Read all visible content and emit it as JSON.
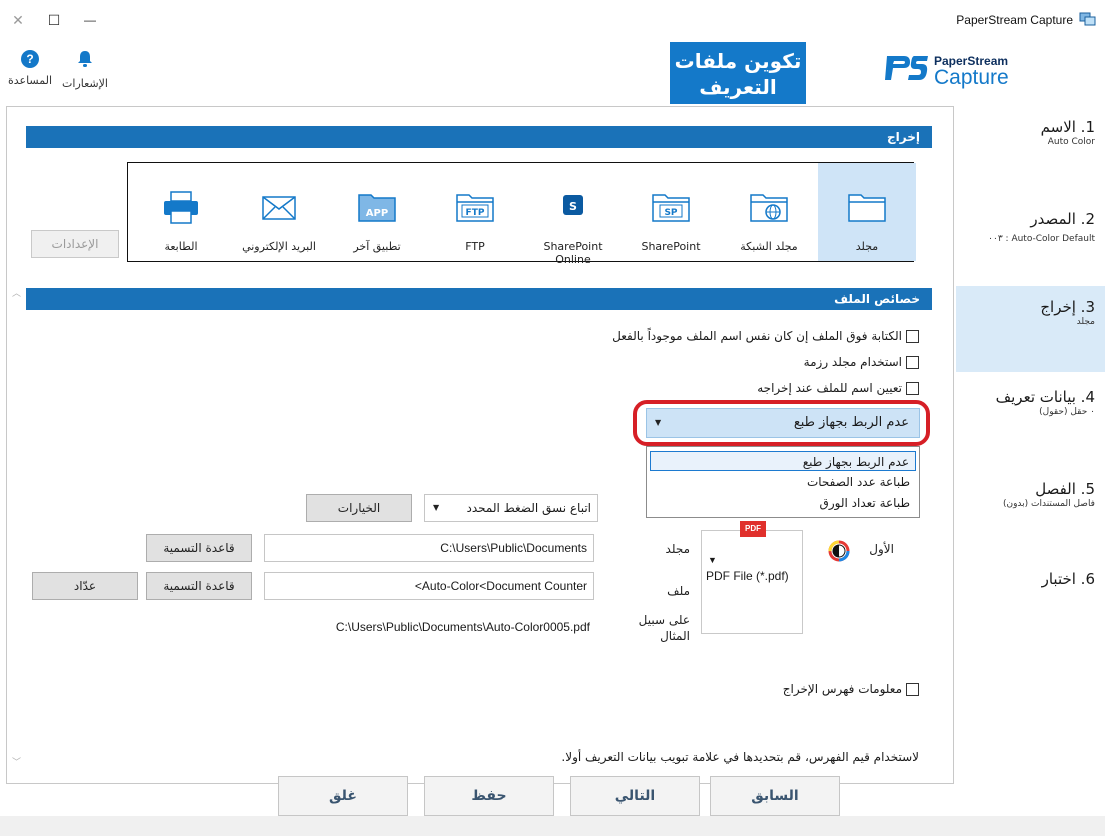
{
  "window": {
    "title": "PaperStream Capture",
    "close_glyph": "✕",
    "maximize_glyph": "☐",
    "minimize_glyph": "—"
  },
  "header": {
    "help_label": "المساعدة",
    "notifications_label": "الإشعارات",
    "profile_title_line1": "تكوين ملفات",
    "profile_title_line2": "التعريف",
    "logo_top": "PaperStream",
    "logo_bottom": "Capture"
  },
  "sections": {
    "output_header": "إخراج",
    "file_props_header": "خصائص الملف"
  },
  "destinations": [
    {
      "label": "مجلد",
      "icon": "folder-icon",
      "selected": true
    },
    {
      "label": "مجلد الشبكة",
      "icon": "network-folder-icon",
      "selected": false
    },
    {
      "label": "SharePoint",
      "icon": "sharepoint-folder-icon",
      "selected": false
    },
    {
      "label": "SharePoint Online",
      "icon": "sharepoint-online-icon",
      "selected": false
    },
    {
      "label": "FTP",
      "icon": "ftp-folder-icon",
      "selected": false
    },
    {
      "label": "تطبيق آخر",
      "icon": "app-folder-icon",
      "selected": false
    },
    {
      "label": "البريد الإلكتروني",
      "icon": "email-icon",
      "selected": false
    },
    {
      "label": "الطابعة",
      "icon": "printer-icon",
      "selected": false
    }
  ],
  "settings_button": "الإعدادات",
  "checkboxes": {
    "overwrite": "الكتابة فوق الملف إن كان نفس اسم الملف موجوداً بالفعل",
    "batch_folder": "استخدام مجلد رزمة",
    "name_on_output": "تعيين اسم للملف عند إخراجه",
    "index_info": "معلومات فهرس الإخراج"
  },
  "printer_link": {
    "selected": "عدم الربط بجهاز طبع",
    "options": [
      "عدم الربط بجهاز طبع",
      "طباعة عدد الصفحات",
      "طباعة تعداد الورق"
    ]
  },
  "compression": {
    "value": "اتباع نسق الضغط المحدد",
    "options_button": "الخيارات"
  },
  "file_type": {
    "label": "الأول",
    "format": "PDF File (*.pdf)",
    "badge": "PDF"
  },
  "folder_field": {
    "label": "مجلد",
    "value": "C:\\Users\\Public\\Documents",
    "rule_button": "قاعدة التسمية"
  },
  "file_field": {
    "label": "ملف",
    "value": "<Auto-Color<Document Counter",
    "rule_button": "قاعدة التسمية",
    "counter_button": "عدّاد"
  },
  "example": {
    "label_line1": "على سبيل",
    "label_line2": "المثال",
    "value": "C:\\Users\\Public\\Documents\\Auto-Color0005.pdf"
  },
  "index_note": "لاستخدام قيم الفهرس، قم بتحديدها في علامة تبويب بيانات التعريف أولا.",
  "nav": [
    {
      "title": "1. الاسم",
      "sub": "Auto Color"
    },
    {
      "title": "2. المصدر",
      "sub": "Auto-Color Default : ٠٠٣"
    },
    {
      "title": "3. إخراج",
      "sub": "مجلد"
    },
    {
      "title": "4. بيانات تعريف",
      "sub": "٠ حقل (حقول)"
    },
    {
      "title": "5. الفصل",
      "sub": "فاصل المستندات (بدون)"
    },
    {
      "title": "6. اختبار",
      "sub": ""
    }
  ],
  "footer": {
    "close": "غلق",
    "save": "حفظ",
    "next": "التالي",
    "back": "السابق"
  },
  "colors": {
    "accent": "#1479c9",
    "section_header": "#1a72b8",
    "highlight_ring": "#d61f26",
    "selected_bg": "#cfe4f7"
  }
}
